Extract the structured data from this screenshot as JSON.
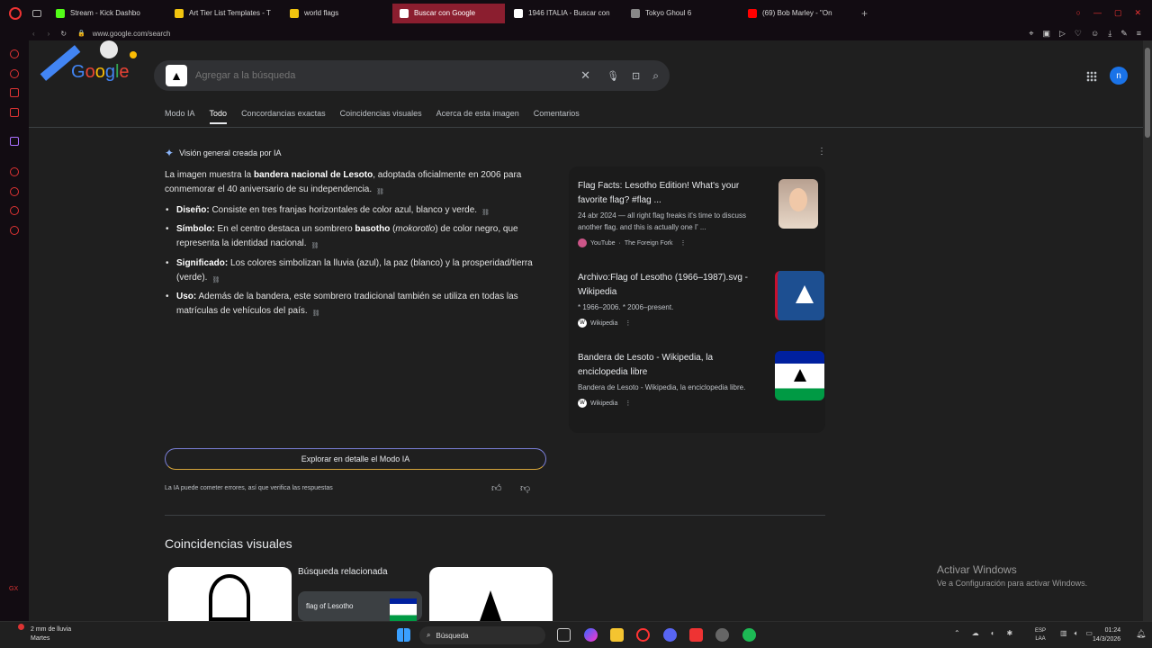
{
  "tabs": [
    {
      "label": "Stream - Kick Dashbo",
      "color": "#53fc18",
      "active": false
    },
    {
      "label": "Art Tier List Templates - T",
      "color": "#f1c40f",
      "active": false
    },
    {
      "label": "world flags",
      "color": "#f1c40f",
      "active": false
    },
    {
      "label": "Buscar con Google",
      "color": "#ffffff",
      "active": true
    },
    {
      "label": "1946 ITALIA - Buscar con",
      "color": "#ffffff",
      "active": false
    },
    {
      "label": "Tokyo Ghoul 6",
      "color": "#888888",
      "active": false
    },
    {
      "label": "(69) Bob Marley - \"On",
      "color": "#ff0000",
      "active": false
    }
  ],
  "address": {
    "url": "www.google.com/search"
  },
  "search": {
    "placeholder": "Agregar a la búsqueda",
    "avatar_letter": "n"
  },
  "nav_tabs": [
    {
      "label": "Modo IA",
      "selected": false
    },
    {
      "label": "Todo",
      "selected": true
    },
    {
      "label": "Concordancias exactas",
      "selected": false
    },
    {
      "label": "Coincidencias visuales",
      "selected": false
    },
    {
      "label": "Acerca de esta imagen",
      "selected": false
    },
    {
      "label": "Comentarios",
      "selected": false
    }
  ],
  "ai_overview": {
    "title": "Visión general creada por IA",
    "intro_a": "La imagen muestra la ",
    "intro_b": "bandera nacional de Lesoto",
    "intro_c": ", adoptada oficialmente en 2006 para conmemorar el 40 aniversario de su independencia.",
    "bullets": [
      {
        "head": "Diseño:",
        "text": " Consiste en tres franjas horizontales de color azul, blanco y verde."
      },
      {
        "head": "Símbolo:",
        "text_a": " En el centro destaca un sombrero ",
        "bold": "basotho",
        "text_b": " (",
        "italic": "mokorotlo",
        "text_c": ") de color negro, que representa la identidad nacional."
      },
      {
        "head": "Significado:",
        "text": " Los colores simbolizan la lluvia (azul), la paz (blanco) y la prosperidad/tierra (verde)."
      },
      {
        "head": "Uso:",
        "text": " Además de la bandera, este sombrero tradicional también se utiliza en todas las matrículas de vehículos del país."
      }
    ],
    "explore_label": "Explorar en detalle el Modo IA",
    "disclaimer": "La IA puede cometer errores, así que verifica las respuestas"
  },
  "sources": [
    {
      "title": "Flag Facts: Lesotho Edition! What's your favorite flag? #flag ...",
      "snippet": "24 abr 2024 — all right flag freaks it's time to discuss another flag. and this is actually one I' ...",
      "site": "YouTube",
      "sub": "The Foreign Fork"
    },
    {
      "title": "Archivo:Flag of Lesotho (1966–1987).svg - Wikipedia",
      "snippet": "* 1966–2006. * 2006–present.",
      "site": "Wikipedia",
      "sub": ""
    },
    {
      "title": "Bandera de Lesoto - Wikipedia, la enciclopedia libre",
      "snippet": "Bandera de Lesoto - Wikipedia, la enciclopedia libre.",
      "site": "Wikipedia",
      "sub": ""
    }
  ],
  "visual_matches": {
    "heading": "Coincidencias visuales",
    "related_label": "Búsqueda relacionada",
    "related_chip": "flag of Lesotho"
  },
  "watermark": {
    "line1": "Activar Windows",
    "line2": "Ve a Configuración para activar Windows."
  },
  "taskbar": {
    "weather_line1": "2 mm de lluvia",
    "weather_line2": "Martes",
    "search_label": "Búsqueda",
    "lang_line1": "ESP",
    "lang_line2": "LAA",
    "time": "01:24",
    "date": "14/3/2026"
  },
  "colors": {
    "lesotho_blue": "#00209f",
    "lesotho_green": "#009a44",
    "accent_tab": "#8b1e2f"
  }
}
